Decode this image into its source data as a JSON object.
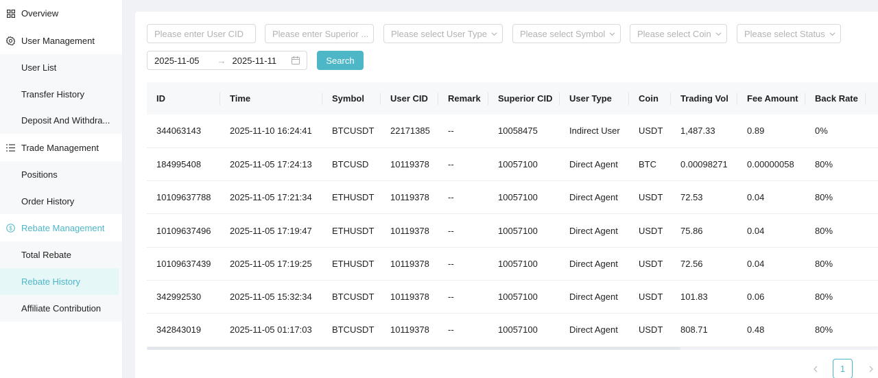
{
  "sidebar": {
    "overview": "Overview",
    "user_management": {
      "label": "User Management",
      "items": [
        "User List",
        "Transfer History",
        "Deposit And Withdra..."
      ]
    },
    "trade_management": {
      "label": "Trade Management",
      "items": [
        "Positions",
        "Order History"
      ]
    },
    "rebate_management": {
      "label": "Rebate Management",
      "items": [
        "Total Rebate",
        "Rebate History",
        "Affiliate Contribution"
      ],
      "selected": "Rebate History"
    }
  },
  "filters": {
    "user_cid_placeholder": "Please enter User CID",
    "superior_placeholder": "Please enter Superior ...",
    "user_type_placeholder": "Please select User Type",
    "symbol_placeholder": "Please select Symbol",
    "coin_placeholder": "Please select Coin",
    "status_placeholder": "Please select Status",
    "date_start": "2025-11-05",
    "date_end": "2025-11-11",
    "date_separator": "→",
    "search_label": "Search"
  },
  "table": {
    "columns": [
      "ID",
      "Time",
      "Symbol",
      "User CID",
      "Remark",
      "Superior CID",
      "User Type",
      "Coin",
      "Trading Vol",
      "Fee Amount",
      "Back Rate",
      ""
    ],
    "rows": [
      [
        "344063143",
        "2025-11-10 16:24:41",
        "BTCUSDT",
        "22171385",
        "--",
        "10058475",
        "Indirect User",
        "USDT",
        "1,487.33",
        "0.89",
        "0%",
        ""
      ],
      [
        "184995408",
        "2025-11-05 17:24:13",
        "BTCUSD",
        "10119378",
        "--",
        "10057100",
        "Direct Agent",
        "BTC",
        "0.00098271",
        "0.00000058",
        "80%",
        ""
      ],
      [
        "10109637788",
        "2025-11-05 17:21:34",
        "ETHUSDT",
        "10119378",
        "--",
        "10057100",
        "Direct Agent",
        "USDT",
        "72.53",
        "0.04",
        "80%",
        ""
      ],
      [
        "10109637496",
        "2025-11-05 17:19:47",
        "ETHUSDT",
        "10119378",
        "--",
        "10057100",
        "Direct Agent",
        "USDT",
        "75.86",
        "0.04",
        "80%",
        ""
      ],
      [
        "10109637439",
        "2025-11-05 17:19:25",
        "ETHUSDT",
        "10119378",
        "--",
        "10057100",
        "Direct Agent",
        "USDT",
        "72.56",
        "0.04",
        "80%",
        ""
      ],
      [
        "342992530",
        "2025-11-05 15:32:34",
        "BTCUSDT",
        "10119378",
        "--",
        "10057100",
        "Direct Agent",
        "USDT",
        "101.83",
        "0.06",
        "80%",
        ""
      ],
      [
        "342843019",
        "2025-11-05 01:17:03",
        "BTCUSDT",
        "10119378",
        "--",
        "10057100",
        "Direct Agent",
        "USDT",
        "808.71",
        "0.48",
        "80%",
        ""
      ]
    ]
  },
  "pagination": {
    "current_page": "1"
  },
  "colors": {
    "accent": "#4db6c7",
    "selected_bg": "#e6f7f8"
  },
  "icons": {
    "overview": "grid-icon",
    "user_management": "gear-icon",
    "trade_management": "list-icon",
    "rebate_management": "dollar-circle-icon"
  }
}
